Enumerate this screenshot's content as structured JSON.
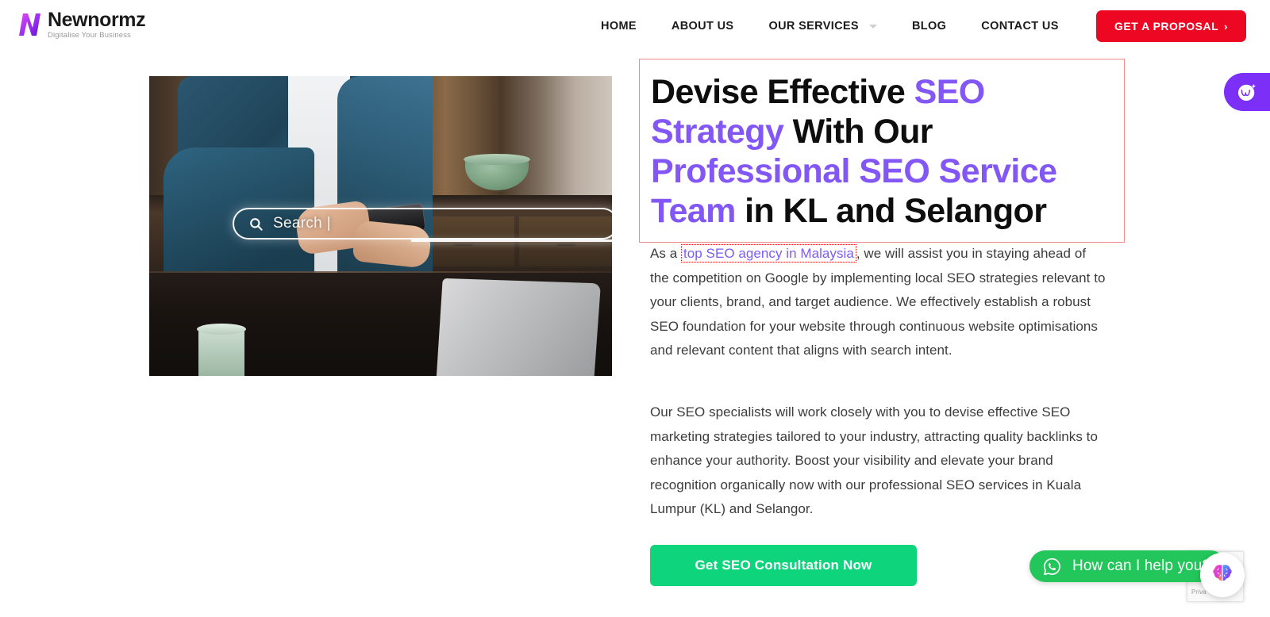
{
  "header": {
    "brand": {
      "name": "Newnormz",
      "tagline": "Digitalise Your Business",
      "logo_icon": "newnormz-n-mark",
      "gradient_from": "#e040fb",
      "gradient_to": "#6a1bd1"
    },
    "nav": [
      {
        "label": "HOME",
        "has_dropdown": false
      },
      {
        "label": "ABOUT US",
        "has_dropdown": false
      },
      {
        "label": "OUR SERVICES",
        "has_dropdown": true
      },
      {
        "label": "BLOG",
        "has_dropdown": false
      },
      {
        "label": "CONTACT US",
        "has_dropdown": false
      }
    ],
    "cta": {
      "label": "GET A PROPOSAL",
      "arrow": "›",
      "color": "#ed0722"
    }
  },
  "hero_image": {
    "alt": "Man in denim jacket using a smartphone at a desk with laptop, tablet and cup",
    "search_overlay": {
      "icon": "search-icon",
      "text": "Search |"
    }
  },
  "content": {
    "headline": {
      "parts": [
        {
          "text": "Devise Effective ",
          "accent": false
        },
        {
          "text": "SEO Strategy",
          "accent": true
        },
        {
          "text": " With Our ",
          "accent": false
        },
        {
          "text": "Professional SEO Service Team",
          "accent": true
        },
        {
          "text": " in KL and Selangor",
          "accent": false
        }
      ],
      "accent_color": "#8257f5",
      "box_border_color": "#f28b8b"
    },
    "paragraph1": {
      "before_link": "As a ",
      "link": "top SEO agency in Malaysia",
      "after_link": ", we will assist you in staying ahead of the competition on Google by implementing local SEO strategies relevant to your clients, brand, and target audience. We effectively establish a robust SEO foundation for your website through continuous website optimisations and relevant content that aligns with search intent.",
      "link_color": "#7c5cf5",
      "link_outline_color": "#ff0000"
    },
    "paragraph2": "Our SEO specialists will work closely with you to devise effective SEO marketing strategies tailored to your industry, attracting quality backlinks to enhance your authority. Boost your visibility and elevate your brand recognition organically now with our professional SEO services in Kuala Lumpur (KL) and Selangor.",
    "cta_button": {
      "label": "Get SEO Consultation Now",
      "color": "#0ed57c"
    }
  },
  "widgets": {
    "elementor_tab": {
      "icon": "elementor-ai-sparkle-icon",
      "color": "#7b2ff7"
    },
    "whatsapp": {
      "icon": "whatsapp-icon",
      "label": "How can I help you?",
      "color": "#23c65a"
    },
    "recaptcha": {
      "icon": "recaptcha-arrow-icon",
      "text": "Priva"
    },
    "brain_bubble": {
      "icon": "ai-brain-icon"
    }
  }
}
